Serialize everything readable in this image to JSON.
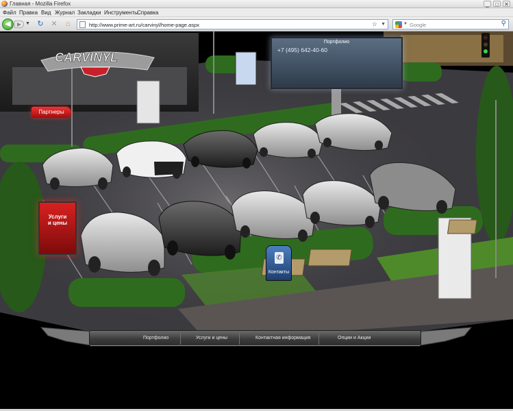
{
  "browser": {
    "window_title": "Главная - Mozilla Firefox",
    "menu": [
      "Файл",
      "Правка",
      "Вид",
      "Журнал",
      "Закладки",
      "Инструменты",
      "Справка"
    ],
    "url": "http://www.prime-art.ru/carvinyl/home-page.aspx",
    "search_placeholder": "Google",
    "controls": {
      "minimize": "_",
      "maximize": "□",
      "close": "✕"
    },
    "icons": {
      "back": "back-arrow-icon",
      "forward": "forward-arrow-icon",
      "reload": "reload-icon",
      "stop": "stop-icon",
      "home": "home-icon",
      "bookmark": "star-icon",
      "search": "magnifier-icon"
    }
  },
  "site": {
    "logo_text": "CARVINYL",
    "partners_label": "Партнеры",
    "billboard": {
      "title": "Портфолио",
      "phone": "+7 (495) 642-40-60"
    },
    "services_sign_lines": [
      "Услуги",
      "и цены"
    ],
    "contacts_label": "Контакты",
    "footer_nav": [
      "Портфолио",
      "Услуги и цены",
      "Контактная информация",
      "Опции и Акции"
    ]
  },
  "colors": {
    "accent_red": "#d92020",
    "nav_green": "#3a9b2d",
    "contacts_blue": "#4c7fc0",
    "asphalt": "#3b3a3e",
    "hedge_green": "#2f6b1f"
  }
}
